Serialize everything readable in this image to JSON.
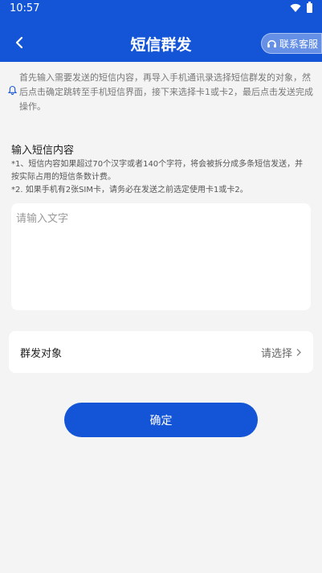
{
  "status": {
    "time": "10:57"
  },
  "nav": {
    "title": "短信群发",
    "service_label": "联系客服"
  },
  "notice": {
    "text": "首先输入需要发送的短信内容，再导入手机通讯录选择短信群发的对象，然后点击确定跳转至手机短信界面，接下来选择卡1或卡2，最后点击发送完成操作。"
  },
  "content": {
    "title": "输入短信内容",
    "hint1": "*1、短信内容如果超过70个汉字或者140个字符，将会被拆分成多条短信发送，并按实际占用的短信条数计费。",
    "hint2": "*2. 如果手机有2张SIM卡，请务必在发送之前选定使用卡1或卡2。",
    "placeholder": "请输入文字",
    "value": ""
  },
  "target": {
    "label": "群发对象",
    "value": "请选择"
  },
  "confirm": {
    "label": "确定"
  },
  "colors": {
    "primary": "#1455d8",
    "background": "#f4f4f4"
  }
}
